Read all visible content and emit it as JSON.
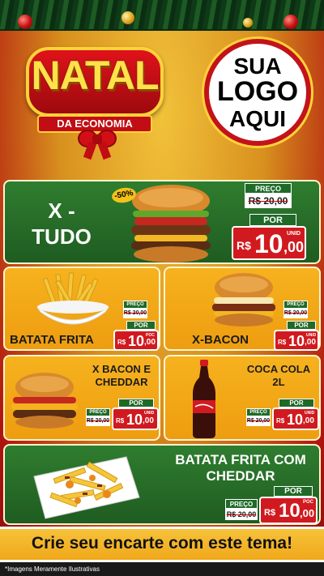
{
  "header": {
    "title_main": "NATAL",
    "title_sub": "DA ECONOMIA",
    "logo_lines": [
      "SUA",
      "LOGO",
      "AQUI"
    ]
  },
  "items": [
    {
      "name_lines": [
        "X -",
        "TUDO"
      ],
      "preco_label": "PREÇO",
      "old_price": "R$ 20,00",
      "por_label": "POR",
      "currency": "R$",
      "price_int": "10",
      "price_dec": ",00",
      "unit": "UNID",
      "badge": "-50%"
    },
    {
      "name": "BATATA FRITA",
      "preco_label": "PREÇO",
      "old_price": "R$ 20,00",
      "por_label": "POR",
      "currency": "R$",
      "price_int": "10",
      "price_dec": ",00",
      "unit": "POC"
    },
    {
      "name": "X-BACON",
      "preco_label": "PREÇO",
      "old_price": "R$ 20,00",
      "por_label": "POR",
      "currency": "R$",
      "price_int": "10",
      "price_dec": ",00",
      "unit": "UNID"
    },
    {
      "name_lines": [
        "X BACON E",
        "CHEDDAR"
      ],
      "preco_label": "PREÇO",
      "old_price": "R$ 20,00",
      "por_label": "POR",
      "currency": "R$",
      "price_int": "10",
      "price_dec": ",00",
      "unit": "UNID"
    },
    {
      "name_lines": [
        "COCA COLA",
        "2L"
      ],
      "preco_label": "PREÇO",
      "old_price": "R$ 20,00",
      "por_label": "POR",
      "currency": "R$",
      "price_int": "10",
      "price_dec": ",00",
      "unit": "UNID"
    },
    {
      "name_lines": [
        "BATATA FRITA COM",
        "CHEDDAR"
      ],
      "preco_label": "PREÇO",
      "old_price": "R$ 20,00",
      "por_label": "POR",
      "currency": "R$",
      "price_int": "10",
      "price_dec": ",00",
      "unit": "POC"
    }
  ],
  "footer": {
    "text": "Crie seu encarte com este tema!"
  },
  "disclaimer": "*Imagens Meramente Ilustrativas",
  "colors": {
    "green": "#1f5c21",
    "orange": "#f6b21e",
    "red": "#d11a1f",
    "gold": "#ffe14a"
  }
}
